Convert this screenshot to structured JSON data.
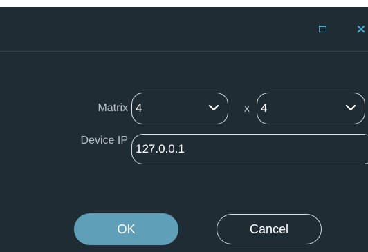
{
  "titlebar": {
    "maximize_icon": "maximize-icon",
    "close_icon": "close-icon",
    "close_glyph": "×"
  },
  "form": {
    "matrix_label": "Matrix",
    "matrix_rows": "4",
    "times_symbol": "x",
    "matrix_cols": "4",
    "device_ip_label": "Device IP",
    "device_ip_value": "127.0.0.1"
  },
  "buttons": {
    "ok_label": "OK",
    "cancel_label": "Cancel"
  },
  "colors": {
    "background": "#1f2c34",
    "accent": "#4aa8cf",
    "primary_button": "#5f9fb7",
    "label_text": "#b9c2c7"
  }
}
